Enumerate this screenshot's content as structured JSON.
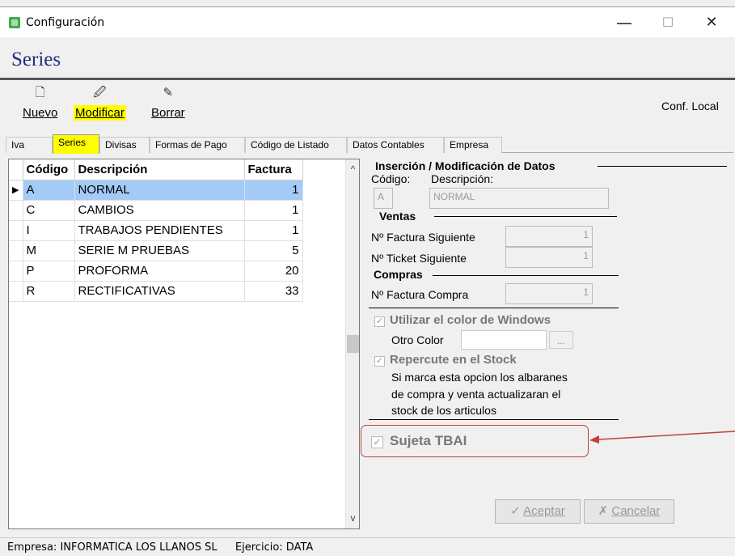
{
  "window": {
    "title": "Configuración",
    "minimize": "—",
    "maximize": "☐",
    "close": "✕"
  },
  "page_title": "Series",
  "toolbar": {
    "nuevo": "Nuevo",
    "modificar": "Modificar",
    "borrar": "Borrar",
    "conf_local": "Conf. Local"
  },
  "tabs": [
    "Iva",
    "Series",
    "Divisas",
    "Formas de Pago",
    "Código de Listado",
    "Datos Contables",
    "Empresa"
  ],
  "grid": {
    "columns": {
      "codigo": "Código",
      "descripcion": "Descripción",
      "factura": "Factura"
    },
    "rows": [
      {
        "codigo": "A",
        "descripcion": "NORMAL",
        "factura": "1"
      },
      {
        "codigo": "C",
        "descripcion": "CAMBIOS",
        "factura": "1"
      },
      {
        "codigo": "I",
        "descripcion": "TRABAJOS PENDIENTES",
        "factura": "1"
      },
      {
        "codigo": "M",
        "descripcion": "SERIE M PRUEBAS",
        "factura": "5"
      },
      {
        "codigo": "P",
        "descripcion": "PROFORMA",
        "factura": "20"
      },
      {
        "codigo": "R",
        "descripcion": "RECTIFICATIVAS",
        "factura": "33"
      }
    ]
  },
  "form": {
    "section_title": "Inserción / Modificación de Datos",
    "codigo_label": "Código:",
    "descripcion_label": "Descripción:",
    "codigo_value": "A",
    "descripcion_value": "NORMAL",
    "ventas_title": "Ventas",
    "factura_siguiente_label": "Nº Factura Siguiente",
    "factura_siguiente_value": "1",
    "ticket_siguiente_label": "Nº Ticket Siguiente",
    "ticket_siguiente_value": "1",
    "compras_title": "Compras",
    "factura_compra_label": "Nº Factura Compra",
    "factura_compra_value": "1",
    "utilizar_color_label": "Utilizar el color de Windows",
    "otro_color_label": "Otro Color",
    "ellipsis": "...",
    "repercute_label": "Repercute en el Stock",
    "repercute_desc_1": "Si marca esta opcion los albaranes",
    "repercute_desc_2": "de compra y venta actualizaran el",
    "repercute_desc_3": "stock de los articulos",
    "sujeta_label": "Sujeta TBAI",
    "aceptar": "Aceptar",
    "cancelar": "Cancelar"
  },
  "status": {
    "empresa": "Empresa: INFORMATICA LOS LLANOS SL",
    "ejercicio": "Ejercicio: DATA"
  },
  "colors": {
    "highlight": "#ffff00",
    "selection": "#a3cbf6",
    "title": "#1f2e80",
    "annotation": "#c0403f"
  }
}
